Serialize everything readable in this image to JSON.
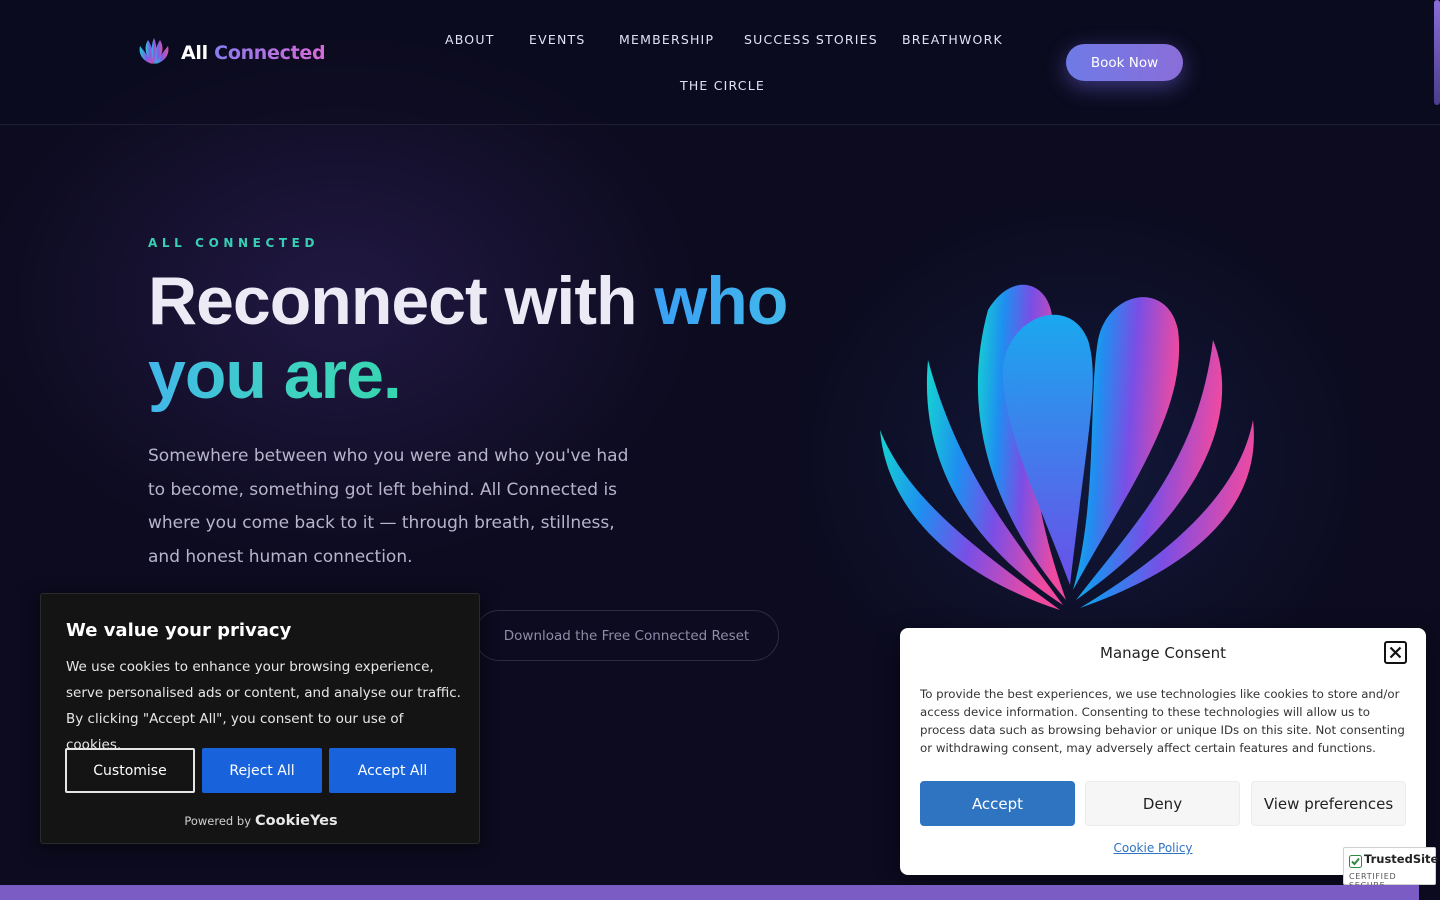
{
  "brand": {
    "word1": "All",
    "word2": "Connected"
  },
  "nav": {
    "items": [
      {
        "label": "ABOUT"
      },
      {
        "label": "EVENTS"
      },
      {
        "label": "MEMBERSHIP"
      },
      {
        "label": "SUCCESS STORIES"
      },
      {
        "label": "BREATHWORK"
      },
      {
        "label": "THE CIRCLE"
      }
    ],
    "cta": "Book Now"
  },
  "hero": {
    "eyebrow": "ALL CONNECTED",
    "headline_plain": "Reconnect with ",
    "headline_accent": "who you are.",
    "lead": "Somewhere between who you were and who you've had to become, something got left behind. All Connected is where you come back to it — through breath, stillness, and honest human connection.",
    "secondary_cta": "Download the Free Connected Reset"
  },
  "cookie_banner": {
    "title": "We value your privacy",
    "text": "We use cookies to enhance your browsing experience, serve personalised ads or content, and analyse our traffic. By clicking \"Accept All\", you consent to our use of cookies.",
    "customise": "Customise",
    "reject": "Reject All",
    "accept": "Accept All",
    "powered_by": "Powered by",
    "powered_brand": "CookieYes"
  },
  "consent_modal": {
    "title": "Manage Consent",
    "text": "To provide the best experiences, we use technologies like cookies to store and/or access device information. Consenting to these technologies will allow us to process data such as browsing behavior or unique IDs on this site. Not consenting or withdrawing consent, may adversely affect certain features and functions.",
    "accept": "Accept",
    "deny": "Deny",
    "preferences": "View preferences",
    "policy_link": "Cookie Policy"
  },
  "trust_badge": {
    "name": "TrustedSite",
    "tagline": "CERTIFIED SECURE"
  },
  "colors": {
    "background": "#0c0b1f",
    "accent_teal": "#37d0b4",
    "accent_blue": "#3aa0f5",
    "cta_purple": "#8a6ed9",
    "cookie_blue": "#1863dc",
    "consent_blue": "#2f74c1",
    "bottom_bar": "#7b5bc4"
  },
  "icons": {
    "logo": "lotus-petals-icon",
    "hero_art": "lotus-petals-illustration",
    "close": "close-icon",
    "trust": "check-icon"
  }
}
